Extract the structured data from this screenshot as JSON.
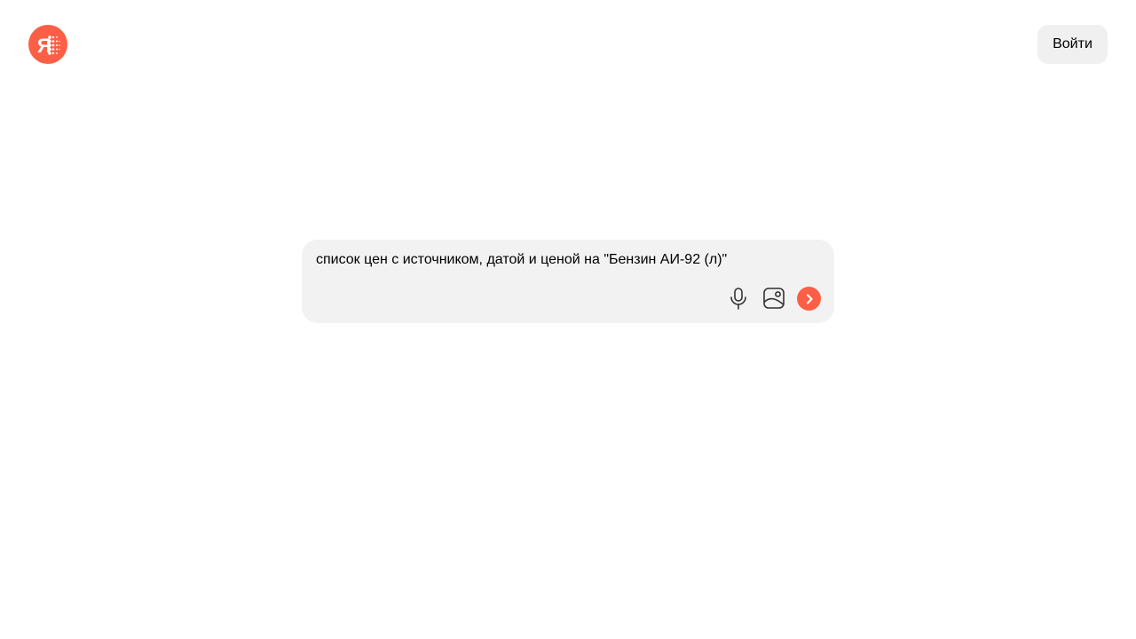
{
  "header": {
    "logo_letter": "Я",
    "login_label": "Войти"
  },
  "search": {
    "query": "список цен с источником, датой и ценой на \"Бензин АИ-92 (л)\"",
    "icons": [
      "microphone-icon",
      "image-search-icon",
      "send-arrow-icon"
    ]
  },
  "colors": {
    "brand": "#fc5f45",
    "search_bg": "#f2f2f2",
    "button_bg": "#f0f0f0"
  }
}
